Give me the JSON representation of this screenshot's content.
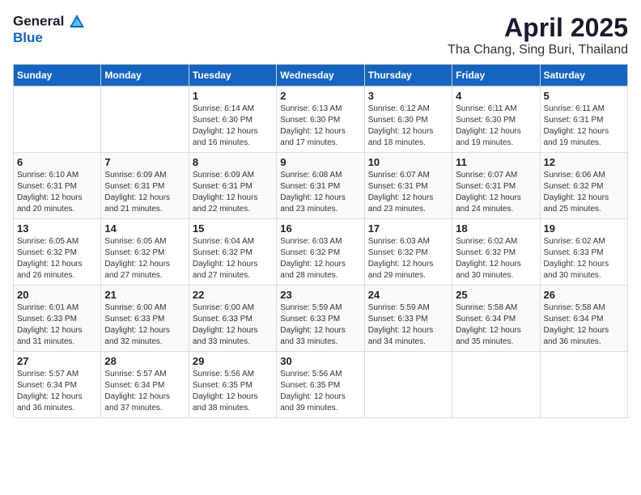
{
  "logo": {
    "text_general": "General",
    "text_blue": "Blue"
  },
  "header": {
    "month_title": "April 2025",
    "location": "Tha Chang, Sing Buri, Thailand"
  },
  "days_of_week": [
    "Sunday",
    "Monday",
    "Tuesday",
    "Wednesday",
    "Thursday",
    "Friday",
    "Saturday"
  ],
  "weeks": [
    [
      {
        "day": "",
        "sunrise": "",
        "sunset": "",
        "daylight": ""
      },
      {
        "day": "",
        "sunrise": "",
        "sunset": "",
        "daylight": ""
      },
      {
        "day": "1",
        "sunrise": "Sunrise: 6:14 AM",
        "sunset": "Sunset: 6:30 PM",
        "daylight": "Daylight: 12 hours and 16 minutes."
      },
      {
        "day": "2",
        "sunrise": "Sunrise: 6:13 AM",
        "sunset": "Sunset: 6:30 PM",
        "daylight": "Daylight: 12 hours and 17 minutes."
      },
      {
        "day": "3",
        "sunrise": "Sunrise: 6:12 AM",
        "sunset": "Sunset: 6:30 PM",
        "daylight": "Daylight: 12 hours and 18 minutes."
      },
      {
        "day": "4",
        "sunrise": "Sunrise: 6:11 AM",
        "sunset": "Sunset: 6:30 PM",
        "daylight": "Daylight: 12 hours and 19 minutes."
      },
      {
        "day": "5",
        "sunrise": "Sunrise: 6:11 AM",
        "sunset": "Sunset: 6:31 PM",
        "daylight": "Daylight: 12 hours and 19 minutes."
      }
    ],
    [
      {
        "day": "6",
        "sunrise": "Sunrise: 6:10 AM",
        "sunset": "Sunset: 6:31 PM",
        "daylight": "Daylight: 12 hours and 20 minutes."
      },
      {
        "day": "7",
        "sunrise": "Sunrise: 6:09 AM",
        "sunset": "Sunset: 6:31 PM",
        "daylight": "Daylight: 12 hours and 21 minutes."
      },
      {
        "day": "8",
        "sunrise": "Sunrise: 6:09 AM",
        "sunset": "Sunset: 6:31 PM",
        "daylight": "Daylight: 12 hours and 22 minutes."
      },
      {
        "day": "9",
        "sunrise": "Sunrise: 6:08 AM",
        "sunset": "Sunset: 6:31 PM",
        "daylight": "Daylight: 12 hours and 23 minutes."
      },
      {
        "day": "10",
        "sunrise": "Sunrise: 6:07 AM",
        "sunset": "Sunset: 6:31 PM",
        "daylight": "Daylight: 12 hours and 23 minutes."
      },
      {
        "day": "11",
        "sunrise": "Sunrise: 6:07 AM",
        "sunset": "Sunset: 6:31 PM",
        "daylight": "Daylight: 12 hours and 24 minutes."
      },
      {
        "day": "12",
        "sunrise": "Sunrise: 6:06 AM",
        "sunset": "Sunset: 6:32 PM",
        "daylight": "Daylight: 12 hours and 25 minutes."
      }
    ],
    [
      {
        "day": "13",
        "sunrise": "Sunrise: 6:05 AM",
        "sunset": "Sunset: 6:32 PM",
        "daylight": "Daylight: 12 hours and 26 minutes."
      },
      {
        "day": "14",
        "sunrise": "Sunrise: 6:05 AM",
        "sunset": "Sunset: 6:32 PM",
        "daylight": "Daylight: 12 hours and 27 minutes."
      },
      {
        "day": "15",
        "sunrise": "Sunrise: 6:04 AM",
        "sunset": "Sunset: 6:32 PM",
        "daylight": "Daylight: 12 hours and 27 minutes."
      },
      {
        "day": "16",
        "sunrise": "Sunrise: 6:03 AM",
        "sunset": "Sunset: 6:32 PM",
        "daylight": "Daylight: 12 hours and 28 minutes."
      },
      {
        "day": "17",
        "sunrise": "Sunrise: 6:03 AM",
        "sunset": "Sunset: 6:32 PM",
        "daylight": "Daylight: 12 hours and 29 minutes."
      },
      {
        "day": "18",
        "sunrise": "Sunrise: 6:02 AM",
        "sunset": "Sunset: 6:32 PM",
        "daylight": "Daylight: 12 hours and 30 minutes."
      },
      {
        "day": "19",
        "sunrise": "Sunrise: 6:02 AM",
        "sunset": "Sunset: 6:33 PM",
        "daylight": "Daylight: 12 hours and 30 minutes."
      }
    ],
    [
      {
        "day": "20",
        "sunrise": "Sunrise: 6:01 AM",
        "sunset": "Sunset: 6:33 PM",
        "daylight": "Daylight: 12 hours and 31 minutes."
      },
      {
        "day": "21",
        "sunrise": "Sunrise: 6:00 AM",
        "sunset": "Sunset: 6:33 PM",
        "daylight": "Daylight: 12 hours and 32 minutes."
      },
      {
        "day": "22",
        "sunrise": "Sunrise: 6:00 AM",
        "sunset": "Sunset: 6:33 PM",
        "daylight": "Daylight: 12 hours and 33 minutes."
      },
      {
        "day": "23",
        "sunrise": "Sunrise: 5:59 AM",
        "sunset": "Sunset: 6:33 PM",
        "daylight": "Daylight: 12 hours and 33 minutes."
      },
      {
        "day": "24",
        "sunrise": "Sunrise: 5:59 AM",
        "sunset": "Sunset: 6:33 PM",
        "daylight": "Daylight: 12 hours and 34 minutes."
      },
      {
        "day": "25",
        "sunrise": "Sunrise: 5:58 AM",
        "sunset": "Sunset: 6:34 PM",
        "daylight": "Daylight: 12 hours and 35 minutes."
      },
      {
        "day": "26",
        "sunrise": "Sunrise: 5:58 AM",
        "sunset": "Sunset: 6:34 PM",
        "daylight": "Daylight: 12 hours and 36 minutes."
      }
    ],
    [
      {
        "day": "27",
        "sunrise": "Sunrise: 5:57 AM",
        "sunset": "Sunset: 6:34 PM",
        "daylight": "Daylight: 12 hours and 36 minutes."
      },
      {
        "day": "28",
        "sunrise": "Sunrise: 5:57 AM",
        "sunset": "Sunset: 6:34 PM",
        "daylight": "Daylight: 12 hours and 37 minutes."
      },
      {
        "day": "29",
        "sunrise": "Sunrise: 5:56 AM",
        "sunset": "Sunset: 6:35 PM",
        "daylight": "Daylight: 12 hours and 38 minutes."
      },
      {
        "day": "30",
        "sunrise": "Sunrise: 5:56 AM",
        "sunset": "Sunset: 6:35 PM",
        "daylight": "Daylight: 12 hours and 39 minutes."
      },
      {
        "day": "",
        "sunrise": "",
        "sunset": "",
        "daylight": ""
      },
      {
        "day": "",
        "sunrise": "",
        "sunset": "",
        "daylight": ""
      },
      {
        "day": "",
        "sunrise": "",
        "sunset": "",
        "daylight": ""
      }
    ]
  ]
}
